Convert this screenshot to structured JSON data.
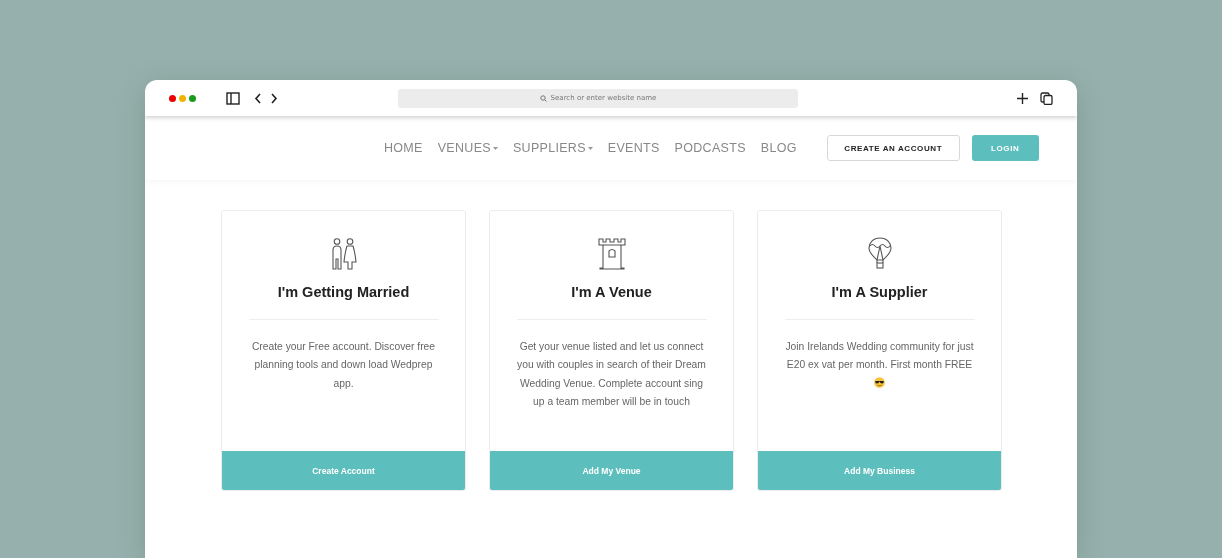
{
  "browser": {
    "address_placeholder": "Search or enter website name"
  },
  "nav": [
    {
      "label": "HOME",
      "dropdown": false
    },
    {
      "label": "VENUES",
      "dropdown": true
    },
    {
      "label": "SUPPLIERS",
      "dropdown": true
    },
    {
      "label": "EVENTS",
      "dropdown": false
    },
    {
      "label": "PODCASTS",
      "dropdown": false
    },
    {
      "label": "BLOG",
      "dropdown": false
    }
  ],
  "header_buttons": [
    {
      "label": "CREATE AN ACCOUNT",
      "kind": "outline"
    },
    {
      "label": "LOGIN",
      "kind": "filled"
    }
  ],
  "cards": [
    {
      "kind": "couple",
      "title": "I'm Getting Married",
      "text": "Create your Free account. Discover free planning tools and down load Wedprep app.",
      "emoji": false,
      "button": "Create Account"
    },
    {
      "kind": "castle",
      "title": "I'm A Venue",
      "text": "Get your venue listed and let us connect you with couples in search of their Dream Wedding Venue. Complete account sing up a team member will be in touch",
      "emoji": false,
      "button": "Add My Venue"
    },
    {
      "kind": "balloon",
      "title": "I'm A Supplier",
      "text": "Join Irelands Wedding community for just E20 ex vat per month. First month FREE",
      "emoji": true,
      "button": "Add My Business"
    }
  ]
}
